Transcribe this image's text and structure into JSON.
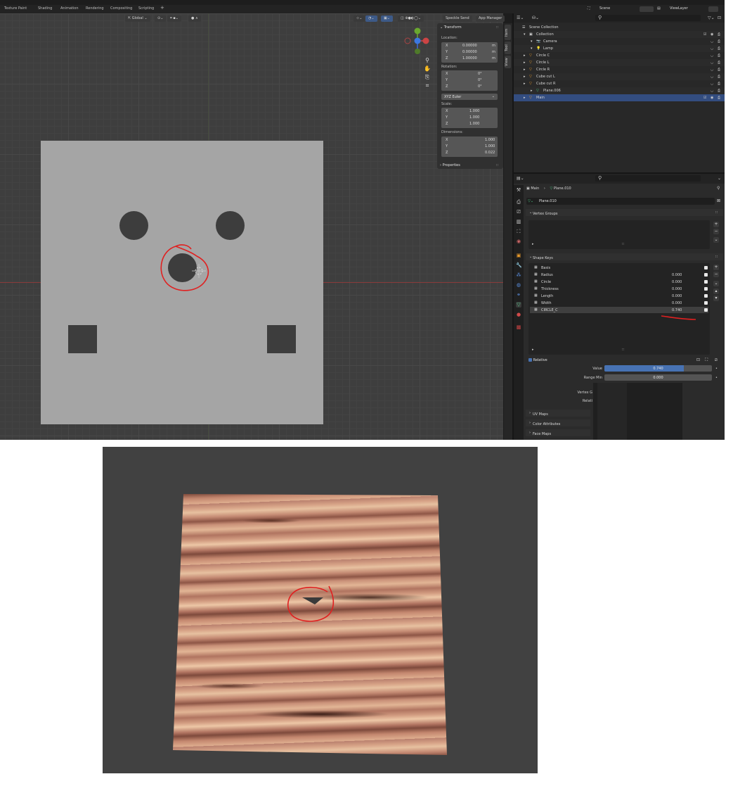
{
  "topbar": {
    "workspace_tabs": [
      "Texture Paint",
      "Shading",
      "Animation",
      "Rendering",
      "Compositing",
      "Scripting"
    ],
    "add_tab": "+",
    "scene_name": "Scene",
    "view_layer": "ViewLayer"
  },
  "viewport": {
    "transform_orientation": "Global",
    "btn_speckle_send": "Speckle Send",
    "btn_app_manager": "App Manager",
    "gizmo_axes": [
      "X",
      "Y",
      "Z"
    ]
  },
  "npanel": {
    "transform_title": "Transform",
    "location_label": "Location:",
    "location": [
      {
        "axis": "X",
        "value": "0.00000",
        "unit": "m"
      },
      {
        "axis": "Y",
        "value": "0.00000",
        "unit": "m"
      },
      {
        "axis": "Z",
        "value": "1.00000",
        "unit": "m"
      }
    ],
    "rotation_label": "Rotation:",
    "rotation": [
      {
        "axis": "X",
        "value": "0°"
      },
      {
        "axis": "Y",
        "value": "0°"
      },
      {
        "axis": "Z",
        "value": "0°"
      }
    ],
    "rotation_mode": "XYZ Euler",
    "scale_label": "Scale:",
    "scale": [
      {
        "axis": "X",
        "value": "1.000"
      },
      {
        "axis": "Y",
        "value": "1.000"
      },
      {
        "axis": "Z",
        "value": "1.000"
      }
    ],
    "dimensions_label": "Dimensions:",
    "dimensions": [
      {
        "axis": "X",
        "value": "1.000"
      },
      {
        "axis": "Y",
        "value": "1.000"
      },
      {
        "axis": "Z",
        "value": "0.022"
      }
    ],
    "properties_title": "Properties",
    "side_tabs": [
      "Item",
      "Tool",
      "View"
    ]
  },
  "outliner": {
    "rows": [
      {
        "label": "Scene Collection",
        "indent": 0
      },
      {
        "label": "Collection",
        "indent": 1
      },
      {
        "label": "Camera",
        "indent": 2
      },
      {
        "label": "Lamp",
        "indent": 2
      },
      {
        "label": "Circle C",
        "indent": 1
      },
      {
        "label": "Circle L",
        "indent": 1
      },
      {
        "label": "Circle R",
        "indent": 1
      },
      {
        "label": "Cube cut L",
        "indent": 1
      },
      {
        "label": "Cube cut R",
        "indent": 1
      },
      {
        "label": "Plane.006",
        "indent": 2
      },
      {
        "label": "Main",
        "indent": 1
      }
    ]
  },
  "properties": {
    "breadcrumb_object": "Main",
    "breadcrumb_mesh": "Plane.010",
    "mesh_name": "Plane.010",
    "vertex_groups_title": "Vertex Groups",
    "shape_keys_title": "Shape Keys",
    "shape_keys": [
      {
        "name": "Basis",
        "value": ""
      },
      {
        "name": "Radius",
        "value": "0.000"
      },
      {
        "name": "Circle",
        "value": "0.000"
      },
      {
        "name": "Thickness",
        "value": "0.000"
      },
      {
        "name": "Length",
        "value": "0.000"
      },
      {
        "name": "Width",
        "value": "0.000"
      },
      {
        "name": "CIRCLE_C",
        "value": "0.740"
      }
    ],
    "relative_label": "Relative",
    "value_label": "Value",
    "value": "0.740",
    "value_fraction": 0.74,
    "range_min_label": "Range Min",
    "range_min": "0.000",
    "vertex_group_label": "Vertex G",
    "relative_to_label": "Relati",
    "uv_maps": "UV Maps",
    "color_attributes": "Color Attributes",
    "face_maps": "Face Maps"
  },
  "colors": {
    "accent": "#4772b3",
    "selection": "#334d80",
    "annotation": "#e02020"
  }
}
